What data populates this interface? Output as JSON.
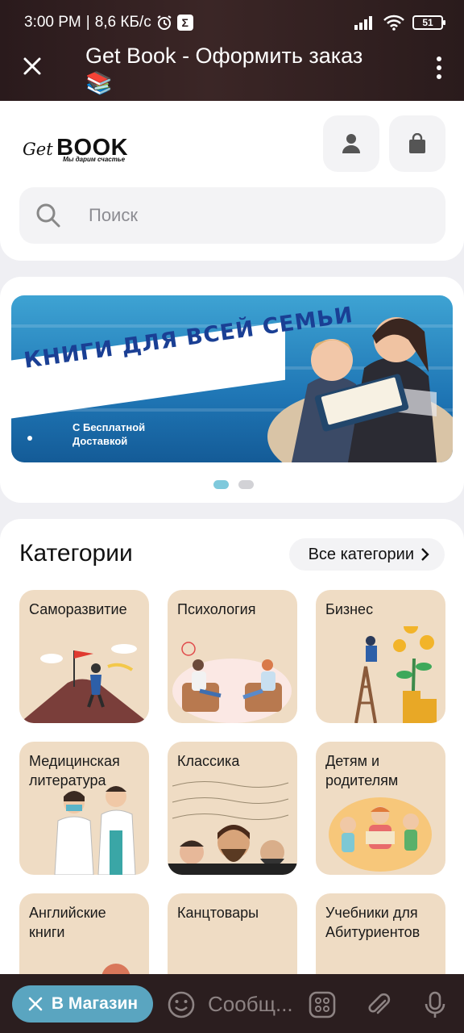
{
  "status_bar": {
    "time": "3:00 PM",
    "speed": "8,6 КБ/с",
    "battery": "51",
    "sep": "|"
  },
  "header": {
    "title": "Get Book - Оформить заказ 📚"
  },
  "logo": {
    "get": "Get",
    "book": "BOOK",
    "slogan": "Мы дарим счастье"
  },
  "search": {
    "placeholder": "Поиск"
  },
  "banner": {
    "headline": "КНИГИ  ДЛЯ ВСЕЙ СЕМЬИ",
    "sub_line1": "С Бесплатной",
    "sub_line2": "Доставкой",
    "pages": 2,
    "active_page": 1
  },
  "categories": {
    "title": "Категории",
    "all_label": "Все категории",
    "items": [
      {
        "label": "Саморазвитие"
      },
      {
        "label": "Психология"
      },
      {
        "label": "Бизнес"
      },
      {
        "label": "Медицинская литература"
      },
      {
        "label": "Классика"
      },
      {
        "label": "Детям и родителям"
      },
      {
        "label": "Английские книги"
      },
      {
        "label": "Канцтовары"
      },
      {
        "label": "Учебники для Абитуриентов"
      }
    ]
  },
  "bottom_bar": {
    "shop_label": "В Магазин",
    "message_placeholder": "Сообщ..."
  },
  "colors": {
    "tile_bg": "#efdcc4",
    "accent": "#5aa5c0",
    "header_bg": "#2a1a1c"
  }
}
